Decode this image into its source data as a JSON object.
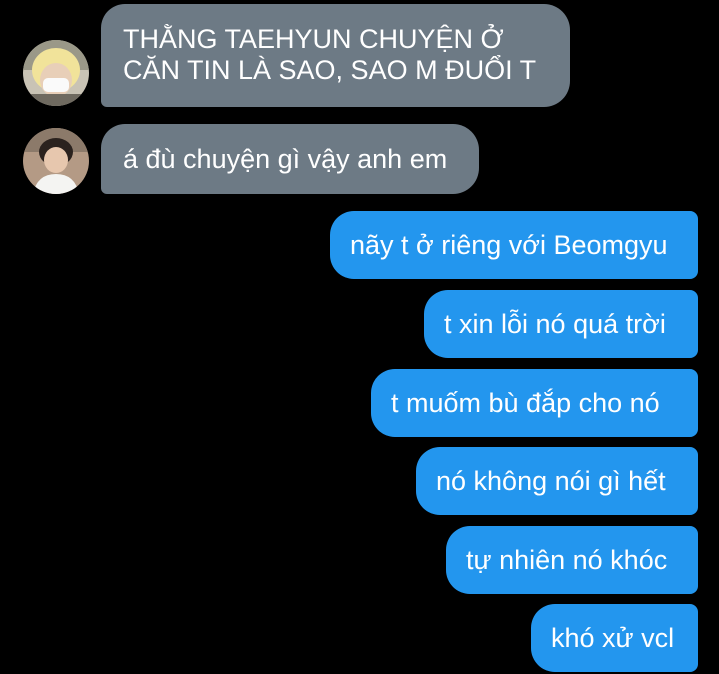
{
  "conversation": {
    "incoming": [
      {
        "avatar": "blonde-masked-user-avatar",
        "lines": [
          "THẰNG TAEHYUN CHUYỆN Ở",
          "CĂN TIN LÀ SAO, SAO M ĐUỔI T"
        ]
      },
      {
        "avatar": "dark-haired-user-avatar",
        "lines": [
          "á đù chuyện gì vậy anh em"
        ]
      }
    ],
    "outgoing": [
      "nãy t ở riêng với Beomgyu",
      "t xin lỗi nó quá trời",
      "t muốm bù đắp cho nó",
      "nó không nói gì hết",
      "tự nhiên nó khóc",
      "khó xử vcl"
    ]
  },
  "colors": {
    "background": "#000000",
    "incoming_bubble": "#6d7a85",
    "outgoing_bubble": "#2396ee",
    "text": "#ffffff"
  }
}
